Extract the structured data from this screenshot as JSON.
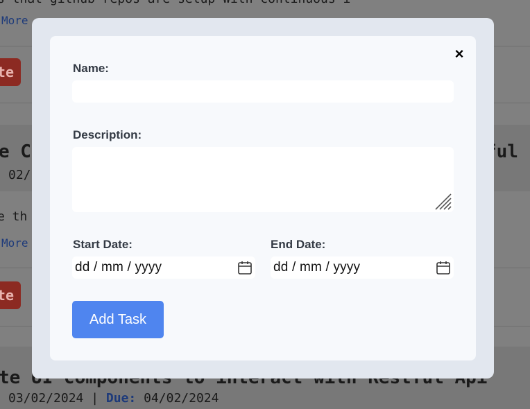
{
  "background": {
    "line1_text": "s that github repos are setup with continuous i",
    "more1": "More",
    "delete1": "te",
    "title2_left": "e C",
    "title2_right": "ful",
    "date2": "02/",
    "desc2": "e th",
    "more2": "More",
    "delete2": "te",
    "title3": "te UI components to interact with Restful Api",
    "date3_start": "03/02/2024",
    "date3_sep": " | ",
    "due_label": "Due:",
    "date3_end": "04/02/2024"
  },
  "modal": {
    "close_label": "×",
    "name_label": "Name:",
    "name_value": "",
    "description_label": "Description:",
    "description_value": "",
    "start_date_label": "Start Date:",
    "start_date_placeholder": "dd / mm / yyyy",
    "end_date_label": "End Date:",
    "end_date_placeholder": "dd / mm / yyyy",
    "submit_label": "Add Task"
  }
}
